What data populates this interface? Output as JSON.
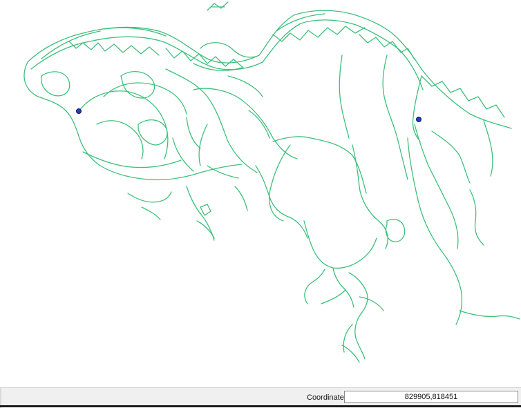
{
  "map": {
    "road_color": "#3cc07a",
    "marker_color": "#1f3fbf",
    "markers": [
      {
        "name": "west-point-marker"
      },
      {
        "name": "east-point-marker"
      }
    ]
  },
  "status_bar": {
    "coordinate_label": "Coordinate",
    "coordinate_value": "829905,818451"
  }
}
